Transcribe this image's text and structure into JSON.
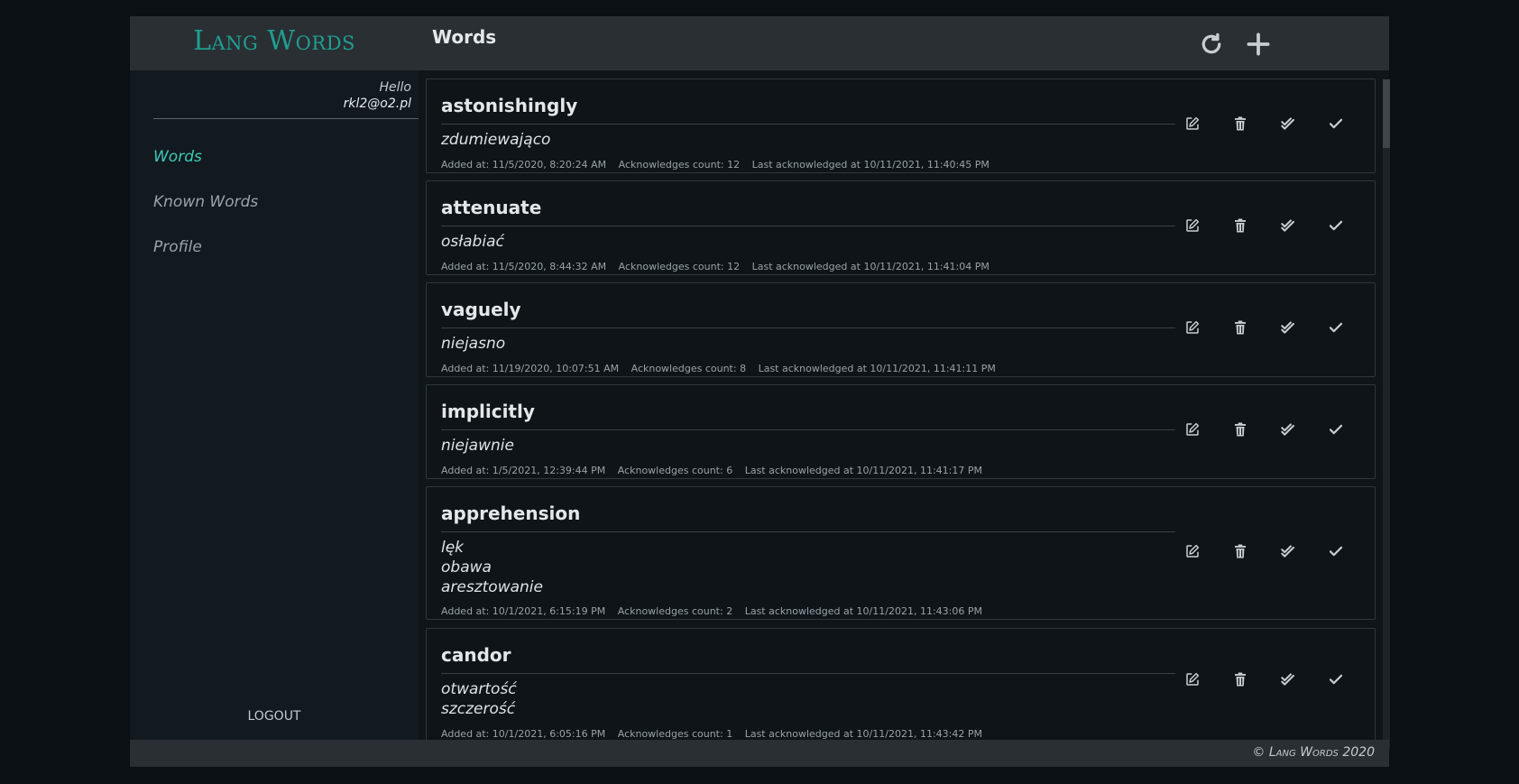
{
  "app": {
    "logo": "Lang Words",
    "page_title": "Words"
  },
  "toolbar": {
    "refresh_icon": "refresh-icon",
    "add_icon": "plus-icon"
  },
  "sidebar": {
    "greeting": "Hello",
    "email": "rkl2@o2.pl",
    "items": [
      {
        "label": "Words",
        "active": true
      },
      {
        "label": "Known Words",
        "active": false
      },
      {
        "label": "Profile",
        "active": false
      }
    ],
    "logout": "LOGOUT"
  },
  "words": [
    {
      "word": "astonishingly",
      "translations": [
        "zdumiewająco"
      ],
      "added": "Added at: 11/5/2020, 8:20:24 AM",
      "count": "Acknowledges count: 12",
      "last": "Last acknowledged at 10/11/2021, 11:40:45 PM"
    },
    {
      "word": "attenuate",
      "translations": [
        "osłabiać"
      ],
      "added": "Added at: 11/5/2020, 8:44:32 AM",
      "count": "Acknowledges count: 12",
      "last": "Last acknowledged at 10/11/2021, 11:41:04 PM"
    },
    {
      "word": "vaguely",
      "translations": [
        "niejasno"
      ],
      "added": "Added at: 11/19/2020, 10:07:51 AM",
      "count": "Acknowledges count: 8",
      "last": "Last acknowledged at 10/11/2021, 11:41:11 PM"
    },
    {
      "word": "implicitly",
      "translations": [
        "niejawnie"
      ],
      "added": "Added at: 1/5/2021, 12:39:44 PM",
      "count": "Acknowledges count: 6",
      "last": "Last acknowledged at 10/11/2021, 11:41:17 PM"
    },
    {
      "word": "apprehension",
      "translations": [
        "lęk",
        "obawa",
        "aresztowanie"
      ],
      "added": "Added at: 10/1/2021, 6:15:19 PM",
      "count": "Acknowledges count: 2",
      "last": "Last acknowledged at 10/11/2021, 11:43:06 PM"
    },
    {
      "word": "candor",
      "translations": [
        "otwartość",
        "szczerość"
      ],
      "added": "Added at: 10/1/2021, 6:05:16 PM",
      "count": "Acknowledges count: 1",
      "last": "Last acknowledged at 10/11/2021, 11:43:42 PM"
    }
  ],
  "word_actions": [
    "edit-icon",
    "trash-icon",
    "double-check-icon",
    "check-icon"
  ],
  "footer": {
    "copyright_symbol": "©",
    "brand": "Lang Words",
    "year": "2020"
  },
  "colors": {
    "accent": "#1f9e91",
    "active_nav": "#3fc8b8",
    "bar_bg": "#2a2f33"
  }
}
